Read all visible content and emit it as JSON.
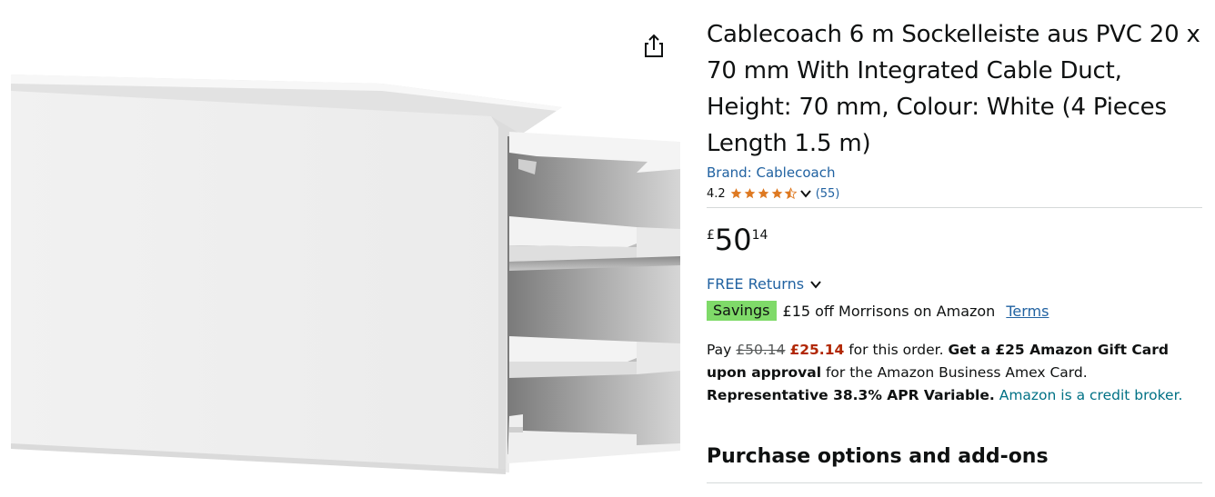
{
  "product": {
    "title": "Cablecoach 6 m Sockelleiste aus PVC 20 x 70 mm With Integrated Cable Duct, Height: 70 mm, Colour: White (4 Pieces Length 1.5 m)",
    "brand": "Brand: Cablecoach",
    "rating": {
      "value": "4.2",
      "stars_out_of_5": 4.2,
      "review_count": "(55)"
    },
    "price": {
      "symbol": "£",
      "whole": "50",
      "fraction": "14"
    },
    "returns_label": "FREE Returns",
    "savings": {
      "badge": "Savings",
      "text": "£15 off Morrisons on Amazon",
      "terms_label": "Terms"
    },
    "promo": {
      "pay_label": "Pay",
      "old_price": "£50.14",
      "new_price": "£25.14",
      "order_text": "for this order.",
      "gift_card_text": "Get a £25 Amazon Gift Card upon approval",
      "card_text": "for the Amazon Business Amex Card.",
      "apr_text": "Representative 38.3% APR Variable.",
      "broker_link": "Amazon is a credit broker."
    },
    "purchase_options_heading": "Purchase options and add-ons"
  },
  "icons": {
    "share": "share-icon",
    "star": "star-icon",
    "chevron": "chevron-down-icon"
  },
  "colors": {
    "link": "#2162A1",
    "star": "#DE7921",
    "savings_badge": "#7FDA69",
    "deal_red": "#B12704",
    "teal_link": "#007185"
  }
}
